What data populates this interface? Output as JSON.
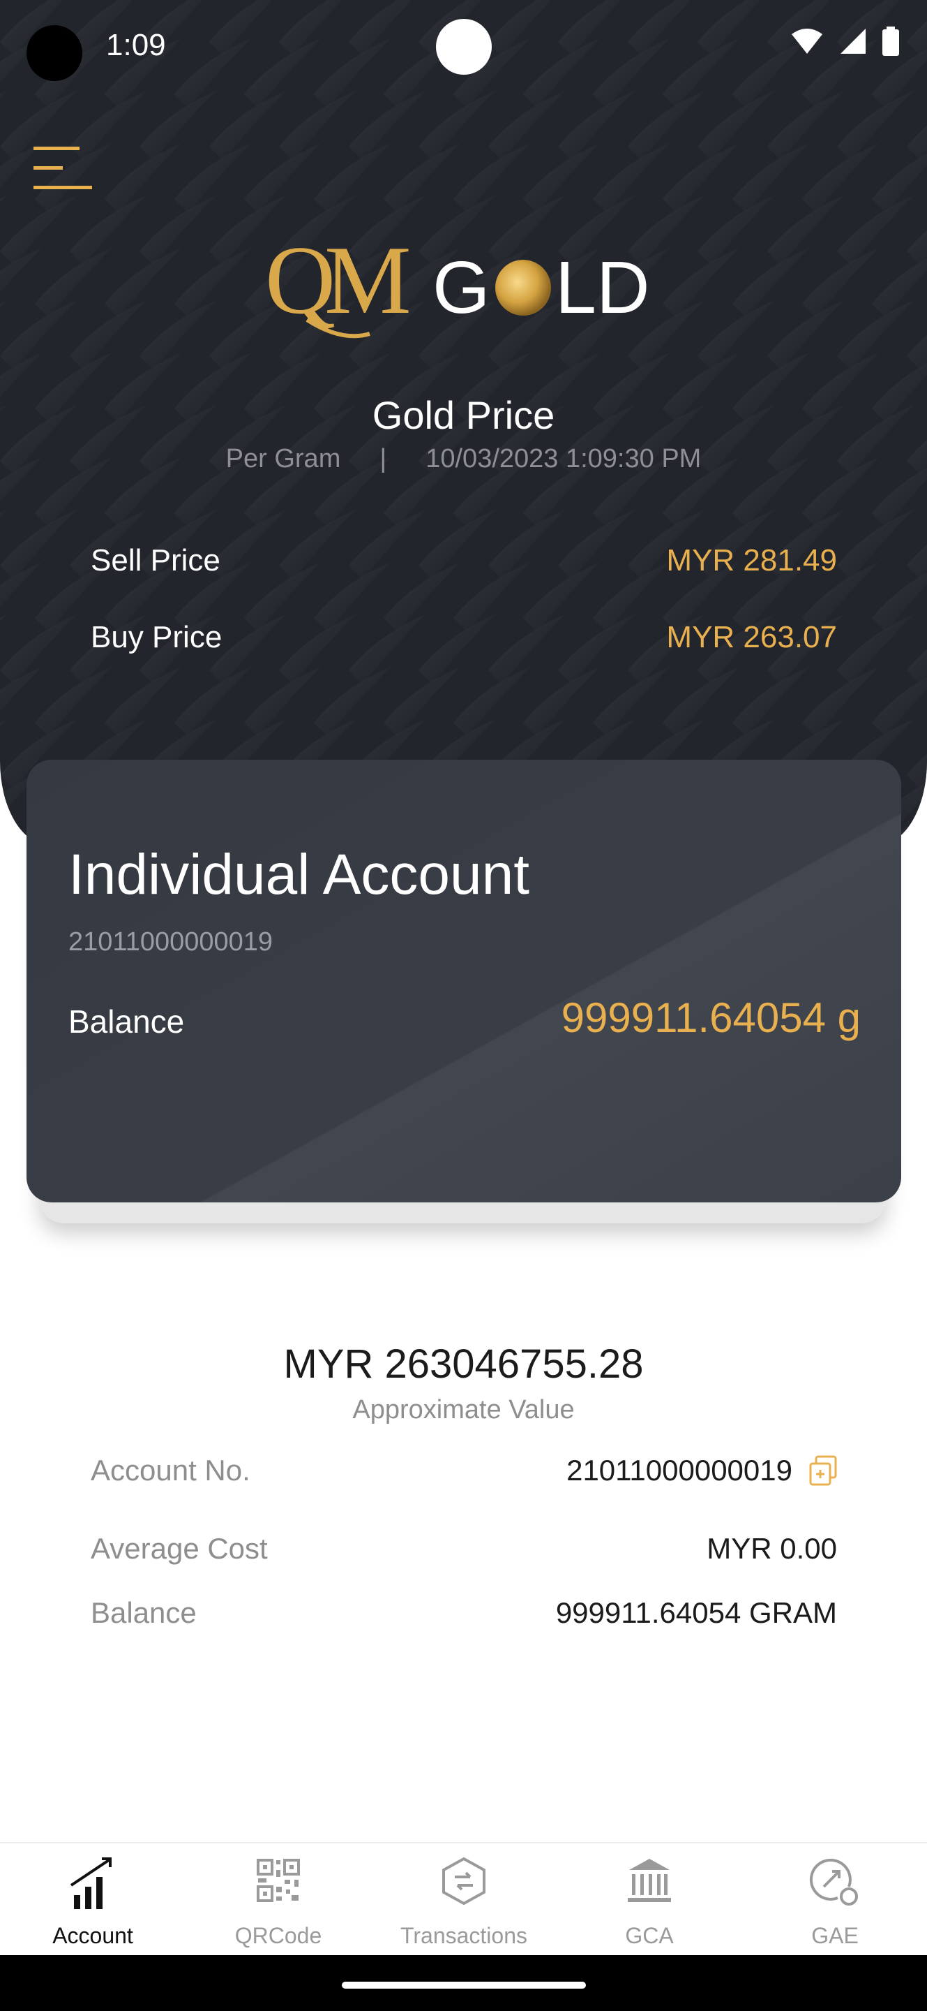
{
  "status_bar": {
    "time": "1:09"
  },
  "brand": {
    "logo_text": "QMGOLD",
    "gold_color": "#e8b04f"
  },
  "gold_price": {
    "title": "Gold Price",
    "unit": "Per Gram",
    "separator": "|",
    "timestamp": "10/03/2023 1:09:30 PM",
    "rows": [
      {
        "label": "Sell Price",
        "value": "MYR 281.49"
      },
      {
        "label": "Buy Price",
        "value": "MYR 263.07"
      }
    ]
  },
  "account_card": {
    "title": "Individual Account",
    "number": "21011000000019",
    "balance_label": "Balance",
    "balance_value": "999911.64054 g"
  },
  "summary": {
    "approx_value": "MYR 263046755.28",
    "approx_label": "Approximate Value"
  },
  "details": [
    {
      "label": "Account No.",
      "value": "21011000000019"
    },
    {
      "label": "Average Cost",
      "value": "MYR 0.00"
    },
    {
      "label": "Balance",
      "value": "999911.64054 GRAM"
    }
  ],
  "nav": [
    {
      "label": "Account",
      "icon": "bar-chart-icon",
      "active": true
    },
    {
      "label": "QRCode",
      "icon": "qrcode-icon",
      "active": false
    },
    {
      "label": "Transactions",
      "icon": "transactions-icon",
      "active": false
    },
    {
      "label": "GCA",
      "icon": "bank-icon",
      "active": false
    },
    {
      "label": "GAE",
      "icon": "gae-icon",
      "active": false
    }
  ]
}
